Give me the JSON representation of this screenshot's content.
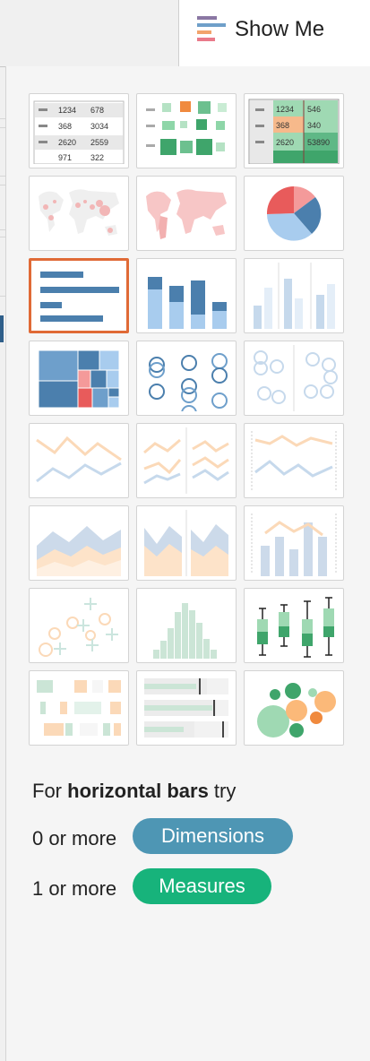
{
  "tab": {
    "label": "Show Me",
    "icon": "show-me-bars-icon"
  },
  "charts": [
    {
      "name": "text-table",
      "icon": "text-table-icon",
      "numbers": [
        "1234",
        "678",
        "368",
        "3034",
        "2620",
        "2559",
        "971",
        "322"
      ]
    },
    {
      "name": "heat-map",
      "icon": "heat-map-icon"
    },
    {
      "name": "highlight-table",
      "icon": "highlight-table-icon",
      "numbers": [
        "1234",
        "546",
        "368",
        "340",
        "2620",
        "53890"
      ]
    },
    {
      "name": "symbol-map",
      "icon": "symbol-map-icon"
    },
    {
      "name": "filled-map",
      "icon": "filled-map-icon"
    },
    {
      "name": "pie-chart",
      "icon": "pie-chart-icon"
    },
    {
      "name": "horizontal-bars",
      "icon": "horizontal-bars-icon",
      "selected": true
    },
    {
      "name": "stacked-bars",
      "icon": "stacked-bars-icon"
    },
    {
      "name": "side-by-side-bars",
      "icon": "side-by-side-bars-icon"
    },
    {
      "name": "treemap",
      "icon": "treemap-icon"
    },
    {
      "name": "circle-views",
      "icon": "circle-views-icon"
    },
    {
      "name": "side-by-side-circles",
      "icon": "side-by-side-circles-icon"
    },
    {
      "name": "continuous-lines",
      "icon": "continuous-lines-icon"
    },
    {
      "name": "discrete-lines",
      "icon": "discrete-lines-icon"
    },
    {
      "name": "dual-lines",
      "icon": "dual-lines-icon"
    },
    {
      "name": "area-continuous",
      "icon": "area-continuous-icon"
    },
    {
      "name": "area-discrete",
      "icon": "area-discrete-icon"
    },
    {
      "name": "dual-combination",
      "icon": "dual-combination-icon"
    },
    {
      "name": "scatter-plot",
      "icon": "scatter-plot-icon"
    },
    {
      "name": "histogram",
      "icon": "histogram-icon"
    },
    {
      "name": "box-whisker",
      "icon": "box-whisker-icon"
    },
    {
      "name": "gantt-chart",
      "icon": "gantt-chart-icon"
    },
    {
      "name": "bullet-graph",
      "icon": "bullet-graph-icon"
    },
    {
      "name": "packed-bubbles",
      "icon": "packed-bubbles-icon"
    }
  ],
  "hint": {
    "prefix": "For ",
    "chart_name": "horizontal bars",
    "suffix": " try",
    "dimensions_prefix": "0 or more",
    "dimensions_label": "Dimensions",
    "measures_prefix": "1 or more",
    "measures_label": "Measures"
  },
  "colors": {
    "accent_selected": "#e06a36",
    "dimensions_pill": "#4e96b4",
    "measures_pill": "#17b37b",
    "bar_blue": "#4b7fad"
  }
}
